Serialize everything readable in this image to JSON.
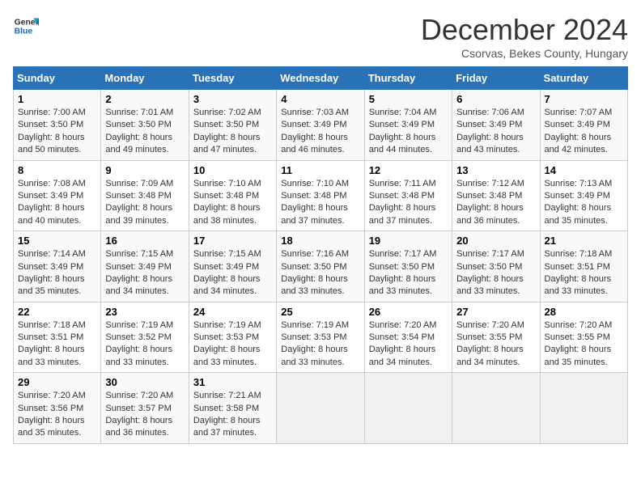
{
  "logo": {
    "line1": "General",
    "line2": "Blue"
  },
  "title": "December 2024",
  "subtitle": "Csorvas, Bekes County, Hungary",
  "days_of_week": [
    "Sunday",
    "Monday",
    "Tuesday",
    "Wednesday",
    "Thursday",
    "Friday",
    "Saturday"
  ],
  "weeks": [
    [
      {
        "day": "1",
        "sunrise": "7:00 AM",
        "sunset": "3:50 PM",
        "daylight": "8 hours and 50 minutes."
      },
      {
        "day": "2",
        "sunrise": "7:01 AM",
        "sunset": "3:50 PM",
        "daylight": "8 hours and 49 minutes."
      },
      {
        "day": "3",
        "sunrise": "7:02 AM",
        "sunset": "3:50 PM",
        "daylight": "8 hours and 47 minutes."
      },
      {
        "day": "4",
        "sunrise": "7:03 AM",
        "sunset": "3:49 PM",
        "daylight": "8 hours and 46 minutes."
      },
      {
        "day": "5",
        "sunrise": "7:04 AM",
        "sunset": "3:49 PM",
        "daylight": "8 hours and 44 minutes."
      },
      {
        "day": "6",
        "sunrise": "7:06 AM",
        "sunset": "3:49 PM",
        "daylight": "8 hours and 43 minutes."
      },
      {
        "day": "7",
        "sunrise": "7:07 AM",
        "sunset": "3:49 PM",
        "daylight": "8 hours and 42 minutes."
      }
    ],
    [
      {
        "day": "8",
        "sunrise": "7:08 AM",
        "sunset": "3:49 PM",
        "daylight": "8 hours and 40 minutes."
      },
      {
        "day": "9",
        "sunrise": "7:09 AM",
        "sunset": "3:48 PM",
        "daylight": "8 hours and 39 minutes."
      },
      {
        "day": "10",
        "sunrise": "7:10 AM",
        "sunset": "3:48 PM",
        "daylight": "8 hours and 38 minutes."
      },
      {
        "day": "11",
        "sunrise": "7:10 AM",
        "sunset": "3:48 PM",
        "daylight": "8 hours and 37 minutes."
      },
      {
        "day": "12",
        "sunrise": "7:11 AM",
        "sunset": "3:48 PM",
        "daylight": "8 hours and 37 minutes."
      },
      {
        "day": "13",
        "sunrise": "7:12 AM",
        "sunset": "3:48 PM",
        "daylight": "8 hours and 36 minutes."
      },
      {
        "day": "14",
        "sunrise": "7:13 AM",
        "sunset": "3:49 PM",
        "daylight": "8 hours and 35 minutes."
      }
    ],
    [
      {
        "day": "15",
        "sunrise": "7:14 AM",
        "sunset": "3:49 PM",
        "daylight": "8 hours and 35 minutes."
      },
      {
        "day": "16",
        "sunrise": "7:15 AM",
        "sunset": "3:49 PM",
        "daylight": "8 hours and 34 minutes."
      },
      {
        "day": "17",
        "sunrise": "7:15 AM",
        "sunset": "3:49 PM",
        "daylight": "8 hours and 34 minutes."
      },
      {
        "day": "18",
        "sunrise": "7:16 AM",
        "sunset": "3:50 PM",
        "daylight": "8 hours and 33 minutes."
      },
      {
        "day": "19",
        "sunrise": "7:17 AM",
        "sunset": "3:50 PM",
        "daylight": "8 hours and 33 minutes."
      },
      {
        "day": "20",
        "sunrise": "7:17 AM",
        "sunset": "3:50 PM",
        "daylight": "8 hours and 33 minutes."
      },
      {
        "day": "21",
        "sunrise": "7:18 AM",
        "sunset": "3:51 PM",
        "daylight": "8 hours and 33 minutes."
      }
    ],
    [
      {
        "day": "22",
        "sunrise": "7:18 AM",
        "sunset": "3:51 PM",
        "daylight": "8 hours and 33 minutes."
      },
      {
        "day": "23",
        "sunrise": "7:19 AM",
        "sunset": "3:52 PM",
        "daylight": "8 hours and 33 minutes."
      },
      {
        "day": "24",
        "sunrise": "7:19 AM",
        "sunset": "3:53 PM",
        "daylight": "8 hours and 33 minutes."
      },
      {
        "day": "25",
        "sunrise": "7:19 AM",
        "sunset": "3:53 PM",
        "daylight": "8 hours and 33 minutes."
      },
      {
        "day": "26",
        "sunrise": "7:20 AM",
        "sunset": "3:54 PM",
        "daylight": "8 hours and 34 minutes."
      },
      {
        "day": "27",
        "sunrise": "7:20 AM",
        "sunset": "3:55 PM",
        "daylight": "8 hours and 34 minutes."
      },
      {
        "day": "28",
        "sunrise": "7:20 AM",
        "sunset": "3:55 PM",
        "daylight": "8 hours and 35 minutes."
      }
    ],
    [
      {
        "day": "29",
        "sunrise": "7:20 AM",
        "sunset": "3:56 PM",
        "daylight": "8 hours and 35 minutes."
      },
      {
        "day": "30",
        "sunrise": "7:20 AM",
        "sunset": "3:57 PM",
        "daylight": "8 hours and 36 minutes."
      },
      {
        "day": "31",
        "sunrise": "7:21 AM",
        "sunset": "3:58 PM",
        "daylight": "8 hours and 37 minutes."
      },
      null,
      null,
      null,
      null
    ]
  ],
  "labels": {
    "sunrise": "Sunrise:",
    "sunset": "Sunset:",
    "daylight": "Daylight:"
  }
}
